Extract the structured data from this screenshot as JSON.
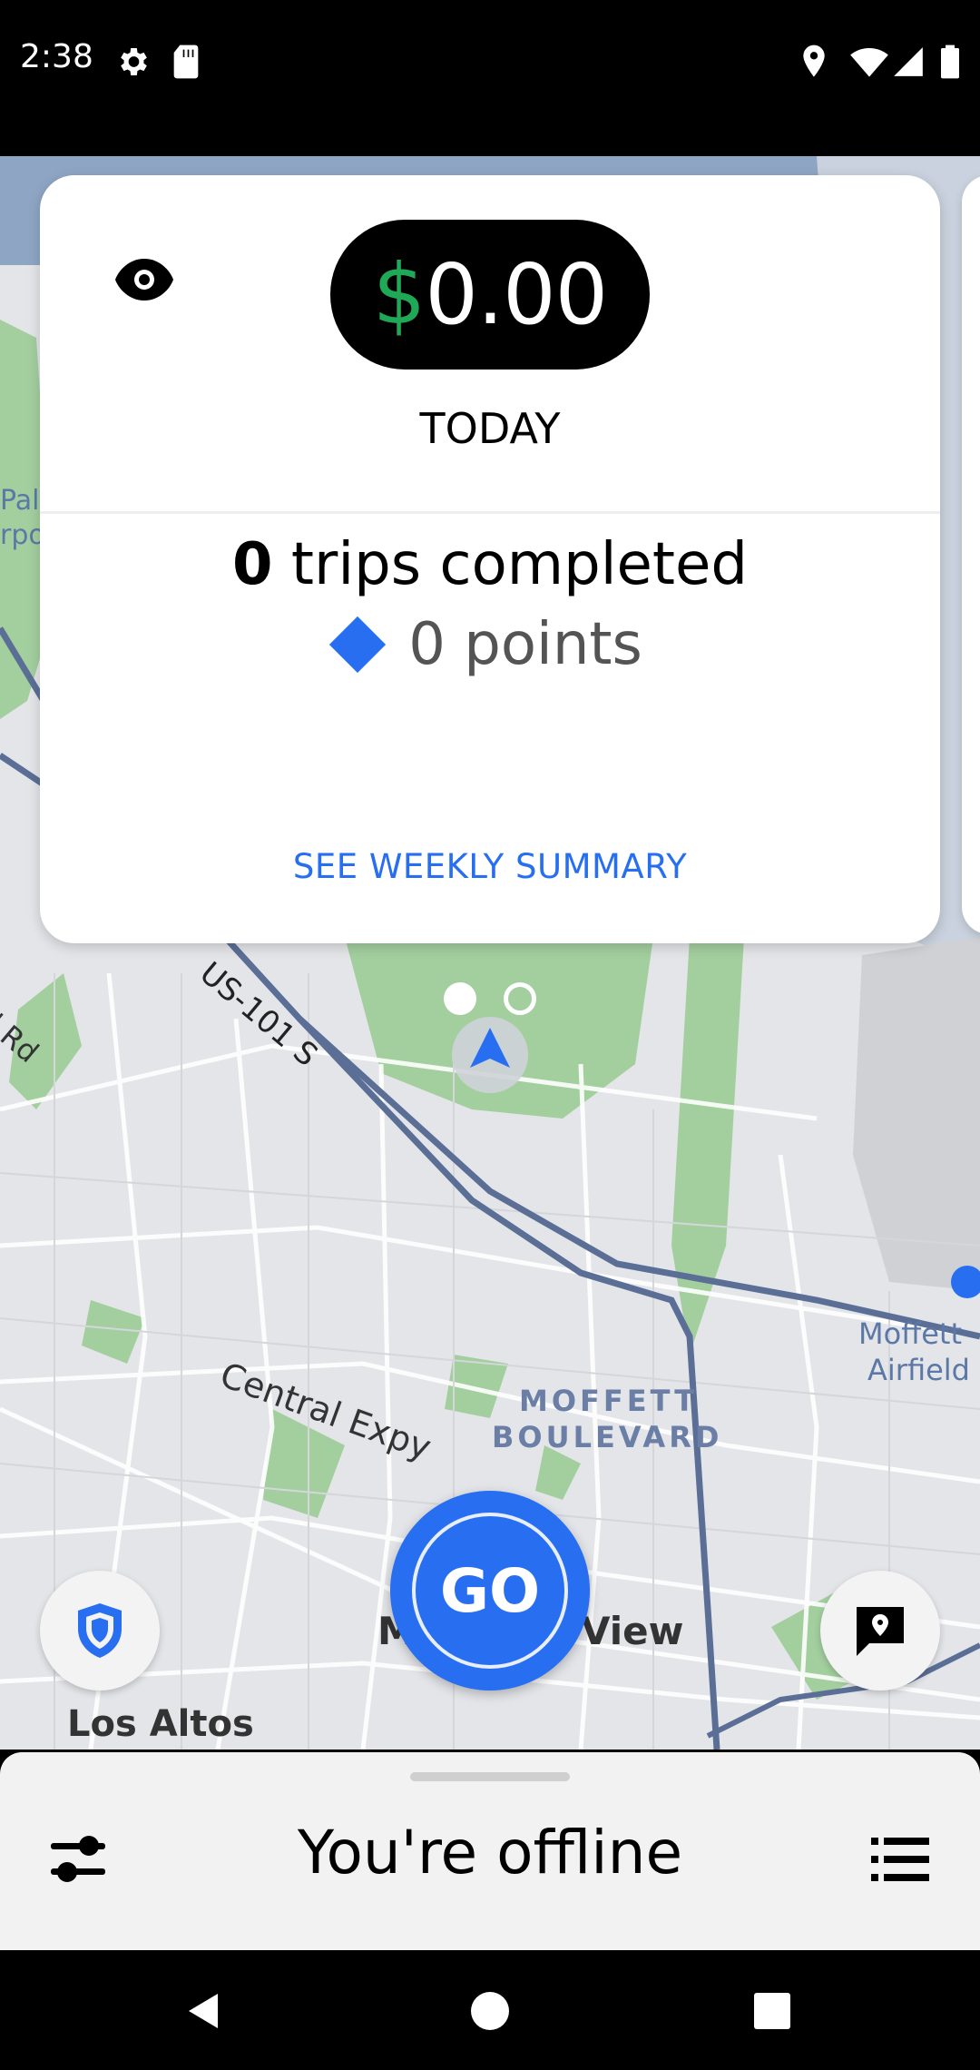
{
  "status_bar": {
    "time": "2:38",
    "icons": [
      "settings-icon",
      "sd-card-icon",
      "location-icon",
      "wifi-icon",
      "signal-icon",
      "battery-icon"
    ]
  },
  "map": {
    "labels": {
      "us101": "US-101 S",
      "central_expy": "Central Expy",
      "moffett_blvd_line1": "MOFFETT",
      "moffett_blvd_line2": "BOULEVARD",
      "moffett_airfield_line1": "Moffett",
      "moffett_airfield_line2": "Airfield",
      "mountain_view_left": "M",
      "mountain_view_right": "View",
      "los_altos": "Los Altos",
      "rd_fragment": "d Rd",
      "pal_fragment": "Pal",
      "rpo_fragment": "rpo"
    }
  },
  "earnings_card": {
    "currency_symbol": "$",
    "amount": "0.00",
    "period": "TODAY",
    "trips_count": "0",
    "trips_label": " trips completed",
    "points": "0 points",
    "weekly_link": "SEE WEEKLY SUMMARY"
  },
  "go_button": {
    "label": "GO"
  },
  "bottom_sheet": {
    "status": "You're offline"
  },
  "colors": {
    "accent_blue": "#276ef1",
    "currency_green": "#1fa855",
    "route_blue": "#5b6f96",
    "park_green": "#a3cf9f"
  }
}
